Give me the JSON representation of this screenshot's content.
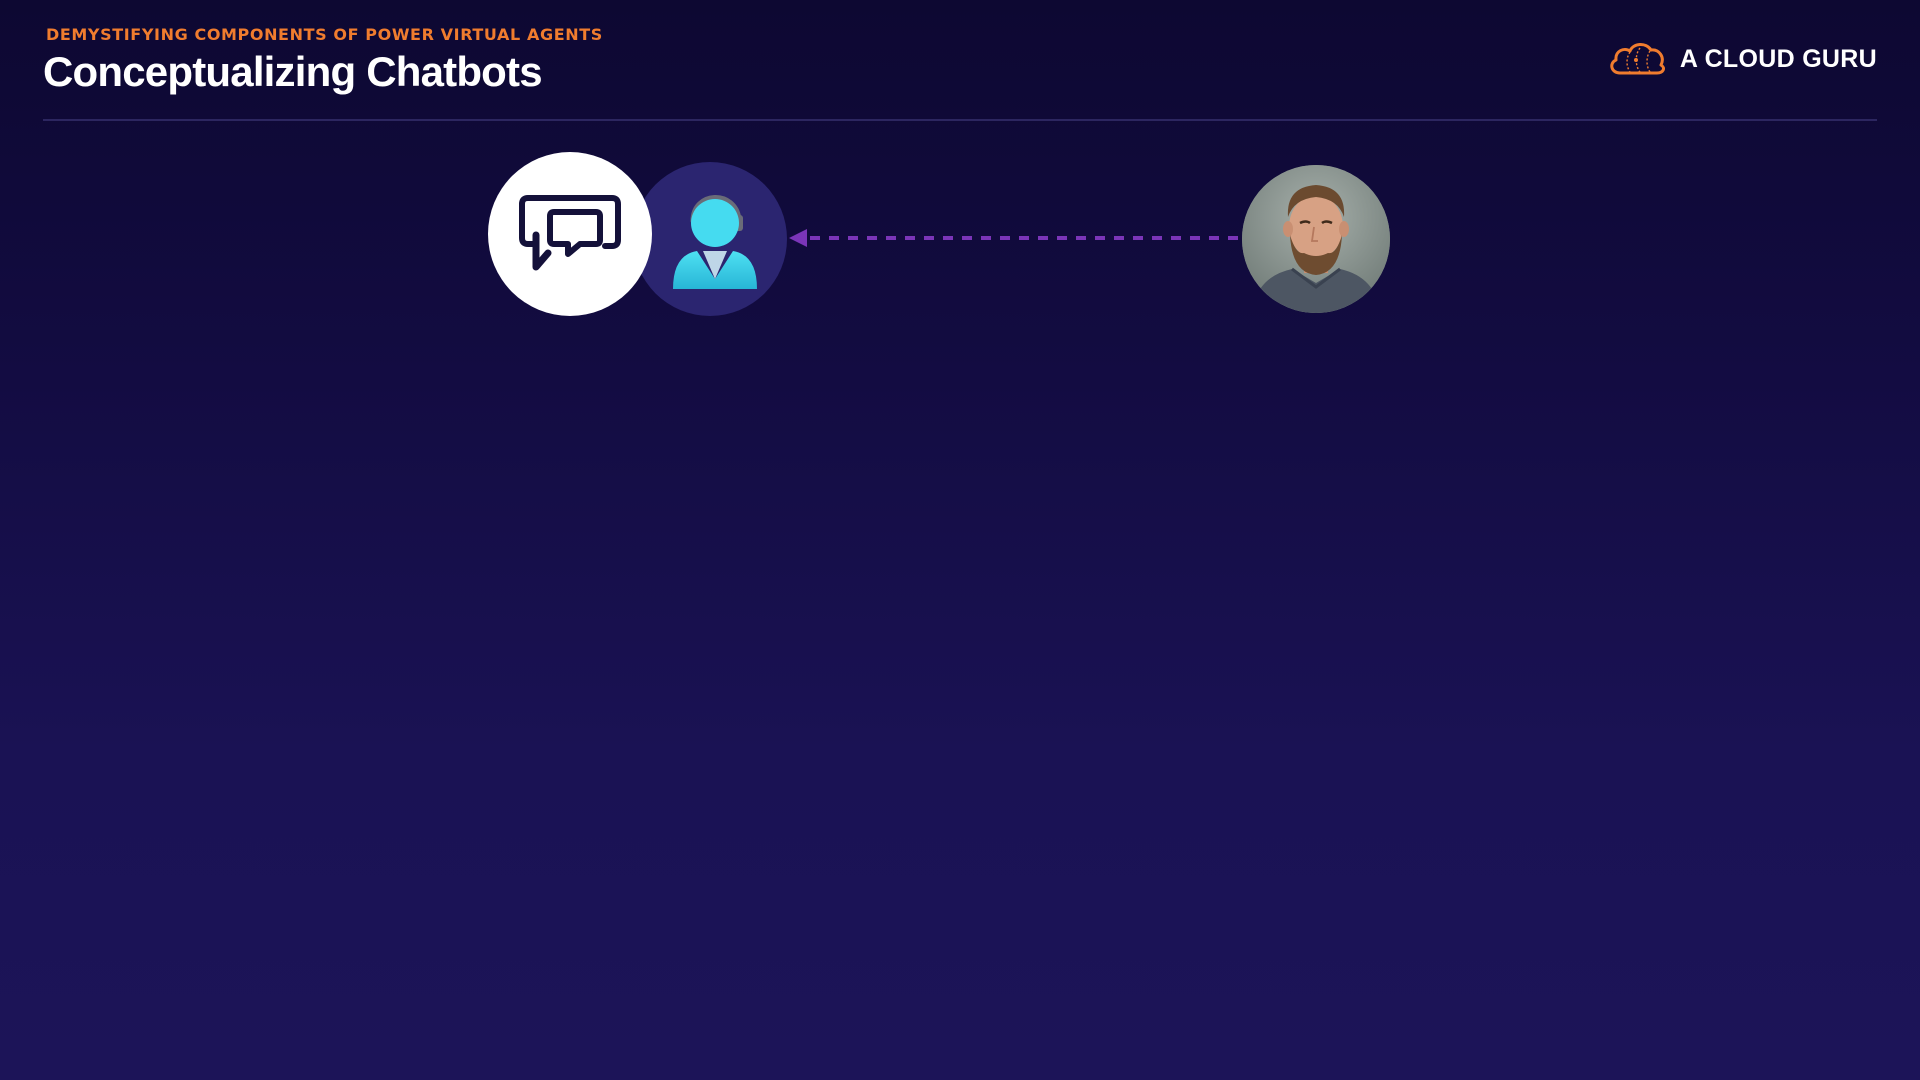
{
  "header": {
    "subtitle": "DEMYSTIFYING COMPONENTS OF POWER VIRTUAL AGENTS",
    "title": "Conceptualizing Chatbots"
  },
  "brand": {
    "name": "A CLOUD GURU",
    "icon": "cloud-logo-icon"
  },
  "diagram": {
    "nodes": [
      {
        "id": "chatbot",
        "icon": "chat-bubbles-icon",
        "background": "#ffffff"
      },
      {
        "id": "agent",
        "icon": "support-agent-icon",
        "background": "#2b2570"
      },
      {
        "id": "user",
        "icon": "person-photo",
        "background": "#7f8a86"
      }
    ],
    "connector": {
      "from": "user",
      "to": "agent",
      "style": "dashed",
      "color": "#7b35b8"
    }
  },
  "colors": {
    "background": "#130c42",
    "accent": "#f07c2e",
    "agent_figure": "#3dd5ec",
    "connector": "#7b35b8"
  }
}
